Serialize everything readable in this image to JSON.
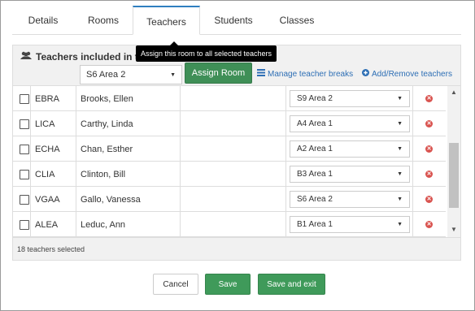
{
  "tabs": [
    {
      "label": "Details"
    },
    {
      "label": "Rooms"
    },
    {
      "label": "Teachers",
      "active": true
    },
    {
      "label": "Students"
    },
    {
      "label": "Classes"
    }
  ],
  "panel": {
    "title": "Teachers included in the event",
    "title_icon": "users-icon",
    "room_select_value": "S6 Area 2",
    "assign_button": "Assign Room",
    "tooltip": "Assign this room to all selected teachers",
    "manage_breaks_link": "Manage teacher breaks",
    "add_remove_link": "Add/Remove teachers",
    "footer_text": "18 teachers selected"
  },
  "rows": [
    {
      "code": "EBRA",
      "name": "Brooks, Ellen",
      "room": "S9 Area 2"
    },
    {
      "code": "LICA",
      "name": "Carthy, Linda",
      "room": "A4 Area 1"
    },
    {
      "code": "ECHA",
      "name": "Chan, Esther",
      "room": "A2 Area 1"
    },
    {
      "code": "CLIA",
      "name": "Clinton, Bill",
      "room": "B3 Area 1"
    },
    {
      "code": "VGAA",
      "name": "Gallo, Vanessa",
      "room": "S6 Area 2"
    },
    {
      "code": "ALEA",
      "name": "Leduc, Ann",
      "room": "B1 Area 1"
    }
  ],
  "buttons": {
    "cancel": "Cancel",
    "save": "Save",
    "save_exit": "Save and exit"
  },
  "colors": {
    "accent_green": "#3f9a5a",
    "link_blue": "#2e6fb5",
    "remove_red": "#d9534f",
    "active_tab_border": "#2f7fc0"
  }
}
